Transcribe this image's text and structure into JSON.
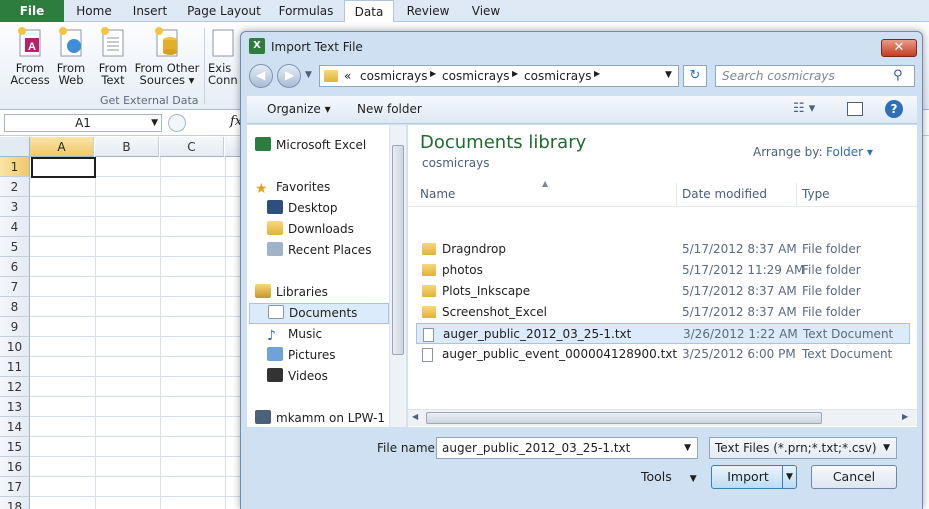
{
  "ribbon": {
    "tabs": [
      "File",
      "Home",
      "Insert",
      "Page Layout",
      "Formulas",
      "Data",
      "Review",
      "View"
    ],
    "buttons": [
      {
        "line1": "From",
        "line2": "Access"
      },
      {
        "line1": "From",
        "line2": "Web"
      },
      {
        "line1": "From",
        "line2": "Text"
      },
      {
        "line1": "From Other",
        "line2": "Sources ▾"
      },
      {
        "line1": "Exis",
        "line2": "Conn"
      }
    ],
    "group_label": "Get External Data"
  },
  "formula_bar": {
    "name_box": "A1",
    "fx": "fx"
  },
  "grid": {
    "columns": [
      "A",
      "B",
      "C"
    ],
    "rows": [
      "1",
      "2",
      "3",
      "4",
      "5",
      "6",
      "7",
      "8",
      "9",
      "10",
      "11",
      "12",
      "13",
      "14",
      "15",
      "16",
      "17",
      "18"
    ]
  },
  "dialog": {
    "title": "Import Text File",
    "close": "✕",
    "breadcrumb": [
      "«",
      "cosmicrays",
      "cosmicrays",
      "cosmicrays"
    ],
    "search_placeholder": "Search cosmicrays",
    "organize": "Organize ▾",
    "new_folder": "New folder",
    "nav": {
      "microsoft_excel": "Microsoft Excel",
      "favorites": "Favorites",
      "desktop": "Desktop",
      "downloads": "Downloads",
      "recent_places": "Recent Places",
      "libraries": "Libraries",
      "documents": "Documents",
      "music": "Music",
      "pictures": "Pictures",
      "videos": "Videos",
      "computer": "mkamm on LPW-1"
    },
    "library_title": "Documents library",
    "library_sub": "cosmicrays",
    "arrange_label": "Arrange by:",
    "arrange_value": "Folder ▾",
    "columns": {
      "name": "Name",
      "date": "Date modified",
      "type": "Type"
    },
    "files": [
      {
        "name": "Dragndrop",
        "date": "5/17/2012 8:37 AM",
        "type": "File folder",
        "kind": "folder"
      },
      {
        "name": "photos",
        "date": "5/17/2012 11:29 AM",
        "type": "File folder",
        "kind": "folder"
      },
      {
        "name": "Plots_Inkscape",
        "date": "5/17/2012 8:37 AM",
        "type": "File folder",
        "kind": "folder"
      },
      {
        "name": "Screenshot_Excel",
        "date": "5/17/2012 8:37 AM",
        "type": "File folder",
        "kind": "folder"
      },
      {
        "name": "auger_public_2012_03_25-1.txt",
        "date": "3/26/2012 1:22 AM",
        "type": "Text Document",
        "kind": "txt"
      },
      {
        "name": "auger_public_event_000004128900.txt",
        "date": "3/25/2012 6:00 PM",
        "type": "Text Document",
        "kind": "txt"
      }
    ],
    "file_name_label": "File name:",
    "file_name_value": "auger_public_2012_03_25-1.txt",
    "file_type_value": "Text Files (*.prn;*.txt;*.csv)",
    "tools": "Tools",
    "import": "Import",
    "cancel": "Cancel"
  }
}
